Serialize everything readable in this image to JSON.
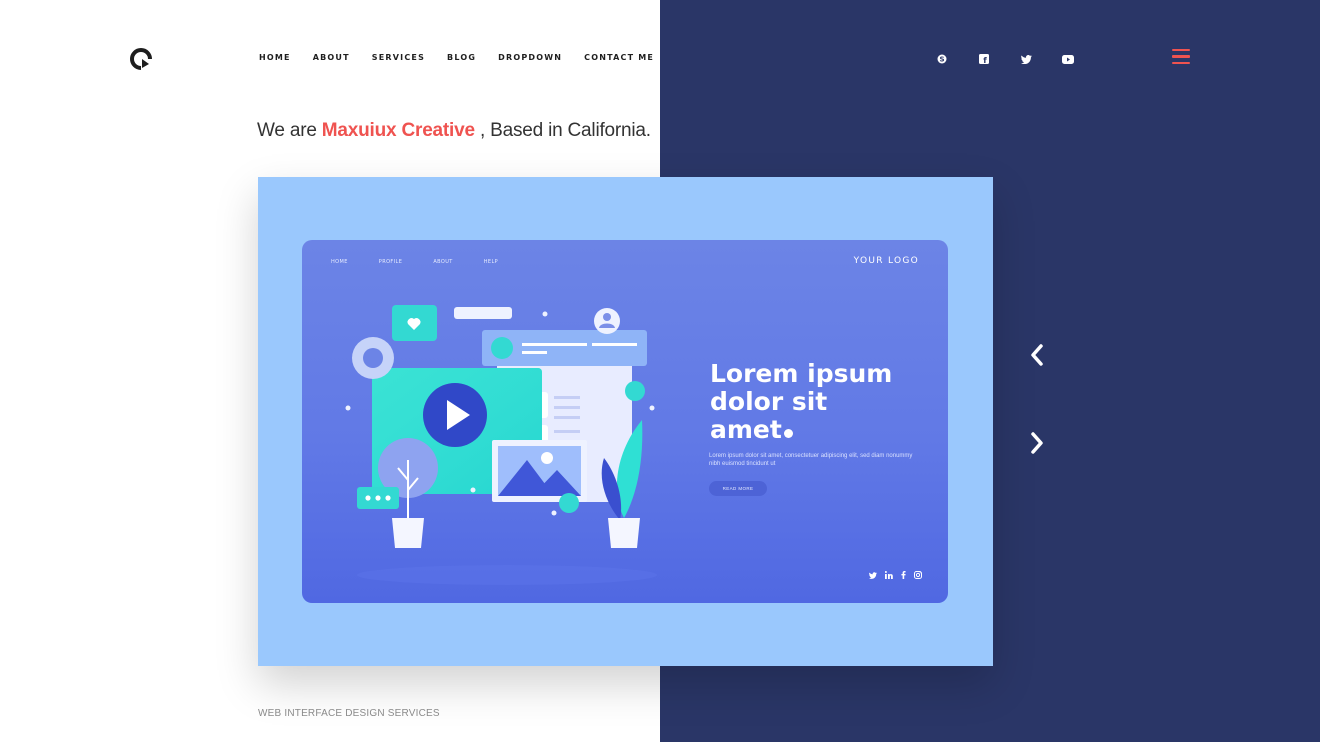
{
  "nav": {
    "items": [
      "HOME",
      "ABOUT",
      "SERVICES",
      "BLOG",
      "DROPDOWN",
      "CONTACT ME"
    ]
  },
  "social": {
    "icons": [
      "skype-icon",
      "facebook-icon",
      "twitter-icon",
      "youtube-icon"
    ]
  },
  "hero": {
    "prefix": "We are ",
    "brand": "Maxuiux Creative",
    "suffix": " , Based in California."
  },
  "slide": {
    "nav": [
      "HOME",
      "PROFILE",
      "ABOUT",
      "HELP"
    ],
    "logo": "YOUR LOGO",
    "title_lines": [
      "Lorem ipsum",
      "dolor sit",
      "amet"
    ],
    "text": "Lorem ipsum dolor sit amet, consectetuer adipiscing elit, sed diam nonummy nibh euismod tincidunt ut",
    "button": "READ MORE",
    "social": [
      "twitter-icon",
      "linkedin-icon",
      "facebook-icon",
      "instagram-icon"
    ]
  },
  "footer": {
    "label": "WEB INTERFACE DESIGN SERVICES"
  },
  "colors": {
    "accent": "#ef5350",
    "dark_panel": "#2a3667",
    "frame": "#9ac8fd",
    "inner": "#6179e6"
  }
}
